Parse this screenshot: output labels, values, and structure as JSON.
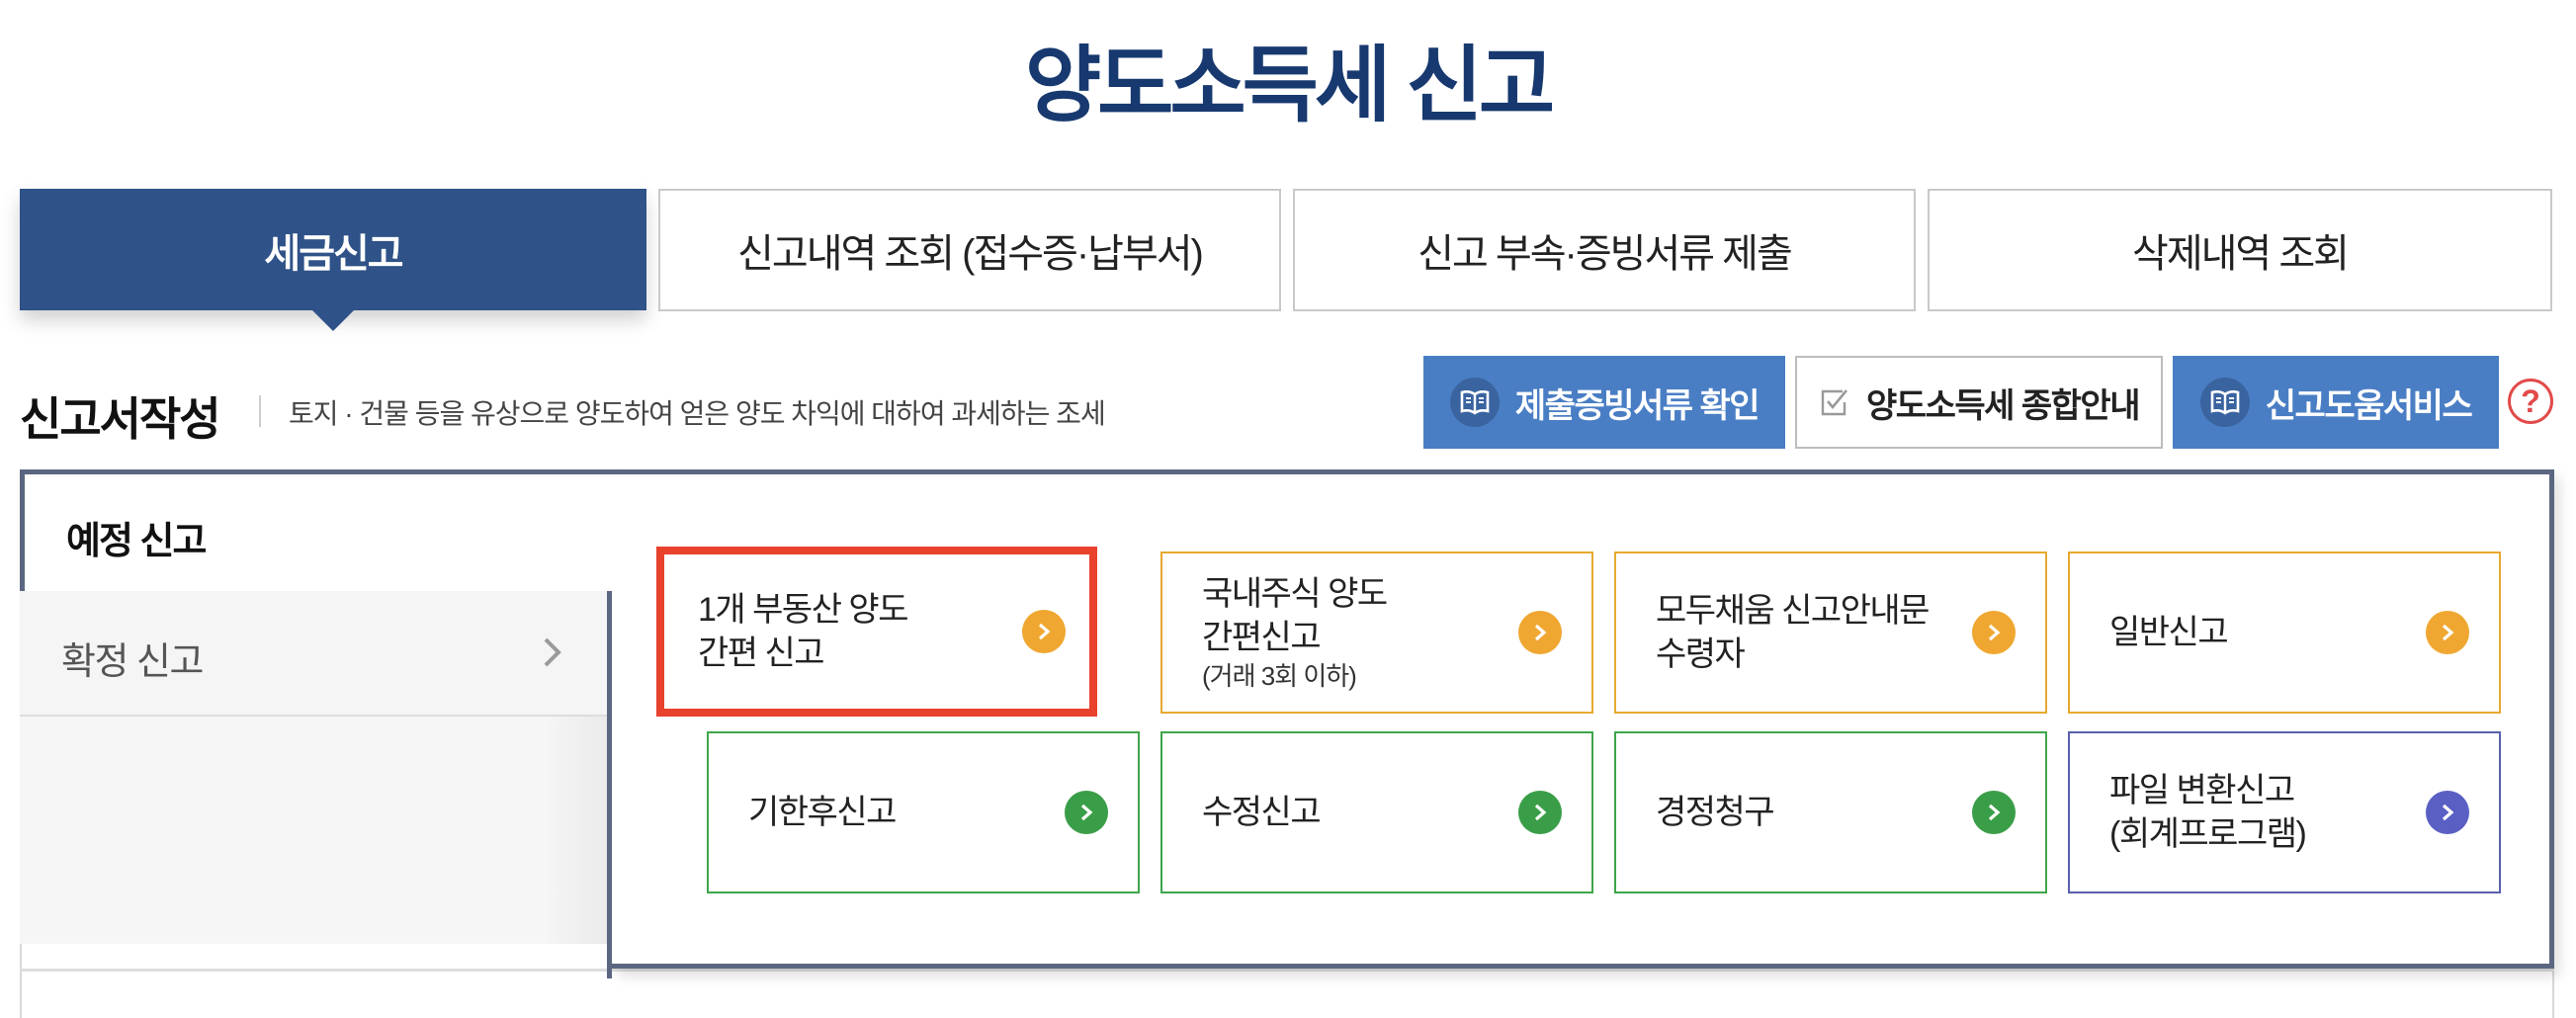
{
  "page": {
    "title": "양도소득세 신고"
  },
  "tabs": [
    {
      "label": "세금신고"
    },
    {
      "label": "신고내역 조회 (접수증·납부서)"
    },
    {
      "label": "신고 부속·증빙서류 제출"
    },
    {
      "label": "삭제내역 조회"
    }
  ],
  "section": {
    "title": "신고서작성",
    "description": "토지 · 건물 등을 유상으로 양도하여 얻은 양도 차익에 대하여 과세하는 조세"
  },
  "toolbar": {
    "submit_docs": "제출증빙서류 확인",
    "guide": "양도소득세 종합안내",
    "help_service": "신고도움서비스",
    "help_icon": "?"
  },
  "side_menu": {
    "preliminary": "예정 신고",
    "final": "확정 신고",
    "chevron": "›"
  },
  "cards": [
    {
      "line1": "1개 부동산 양도",
      "line2": "간편 신고",
      "color": "#efa731",
      "highlighted": true
    },
    {
      "line1": "국내주식 양도",
      "line2": "간편신고",
      "small": "(거래 3회 이하)",
      "color": "#efa731"
    },
    {
      "line1": "모두채움 신고안내문",
      "line2": "수령자",
      "color": "#efa731"
    },
    {
      "line1": "일반신고",
      "color": "#efa731"
    },
    {
      "line1": "기한후신고",
      "color": "#3a9e48"
    },
    {
      "line1": "수정신고",
      "color": "#3a9e48"
    },
    {
      "line1": "경정청구",
      "color": "#3a9e48"
    },
    {
      "line1": "파일 변환신고",
      "line2": "(회계프로그램)",
      "color": "#5a5fc4"
    }
  ],
  "colors": {
    "title": "#17396f",
    "active_tab": "#2f5288",
    "tool_button": "#4a7ec4",
    "highlight_border": "#e8412c"
  },
  "icons": {
    "submit_docs": "book-icon",
    "guide": "checkbox-icon",
    "help_service": "book-icon",
    "help": "question-circle-icon",
    "card_arrow": "chevron-right-circle-icon"
  }
}
